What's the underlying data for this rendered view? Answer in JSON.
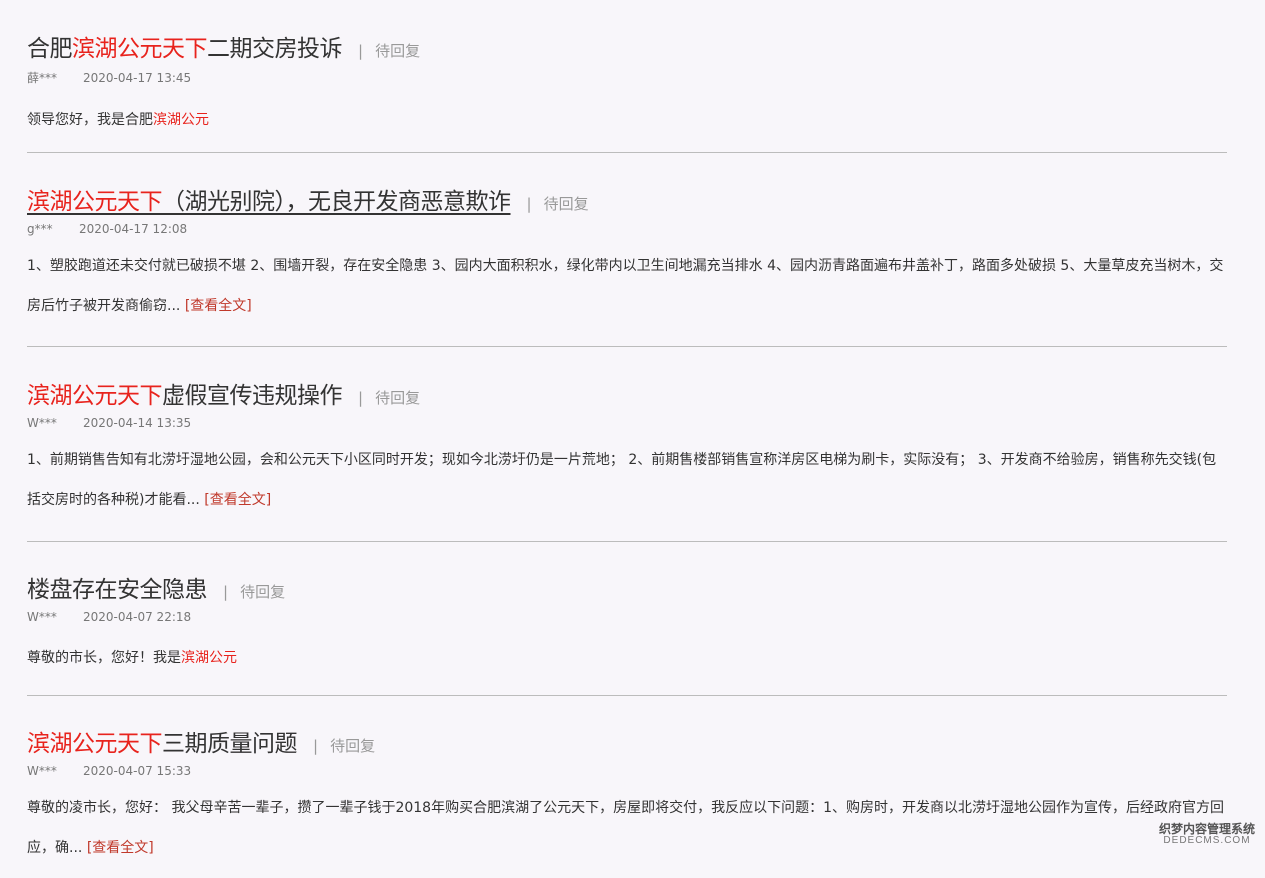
{
  "posts": [
    {
      "title_pre": "合肥",
      "title_hl": "滨湖公元天下",
      "title_post": "二期交房投诉",
      "status": "待回复",
      "user": "薛***",
      "date": "2020-04-17 13:45",
      "body_pre": "领导您好，我是合肥",
      "body_hl": "滨湖公元",
      "body_cont": "",
      "more": ""
    },
    {
      "title_pre": "",
      "title_hl": "滨湖公元天下",
      "title_post": "（湖光别院），无良开发商恶意欺诈",
      "status": "待回复",
      "user": "g***",
      "date": "2020-04-17 12:08",
      "body_pre": "1、塑胶跑道还未交付就已破损不堪 2、围墙开裂，存在安全隐患 3、园内大面积积水，绿化带内以卫生间地漏充当排水 4、园内沥青路面遍布井盖补丁，路面多处破损 5、大量草皮充当树木，交房后竹子被开发商偷窃...",
      "body_hl": "",
      "body_cont": "",
      "more": "[查看全文]"
    },
    {
      "title_pre": "",
      "title_hl": "滨湖公元天下",
      "title_post": "虚假宣传违规操作",
      "status": "待回复",
      "user": "W***",
      "date": "2020-04-14 13:35",
      "body_pre": "1、前期销售告知有北涝圩湿地公园，会和公元天下小区同时开发；现如今北涝圩仍是一片荒地； 2、前期售楼部销售宣称洋房区电梯为刷卡，实际没有； 3、开发商不给验房，销售称先交钱(包括交房时的各种税)才能看...",
      "body_hl": "",
      "body_cont": "",
      "more": "[查看全文]"
    },
    {
      "title_pre": "楼盘存在安全隐患",
      "title_hl": "",
      "title_post": "",
      "status": "待回复",
      "user": "W***",
      "date": "2020-04-07 22:18",
      "body_pre": "尊敬的市长，您好！我是",
      "body_hl": "滨湖公元",
      "body_cont": "",
      "more": ""
    },
    {
      "title_pre": "",
      "title_hl": "滨湖公元天下",
      "title_post": "三期质量问题",
      "status": "待回复",
      "user": "W***",
      "date": "2020-04-07 15:33",
      "body_pre": "尊敬的凌市长，您好： 我父母辛苦一辈子，攒了一辈子钱于2018年购买合肥滨湖了公元天下，房屋即将交付，我反应以下问题：1、购房时，开发商以北涝圩湿地公园作为宣传，后经政府官方回应，确...",
      "body_hl": "",
      "body_cont": "",
      "more": "[查看全文]"
    }
  ],
  "watermark": {
    "cn": "织梦内容管理系统",
    "en": "DEDECMS.COM"
  },
  "colors": {
    "highlight": "#e8231d",
    "link": "#c0392b",
    "background": "#f8f6fa"
  }
}
